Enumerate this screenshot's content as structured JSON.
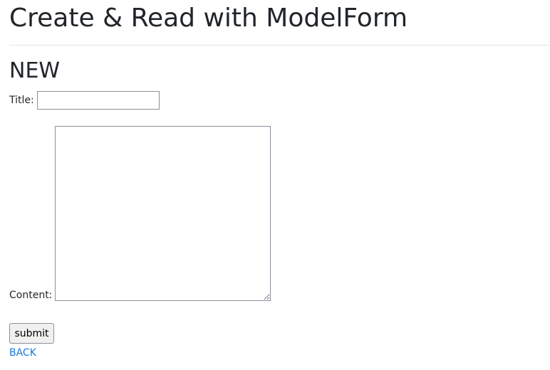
{
  "header": {
    "title": "Create & Read with ModelForm"
  },
  "section": {
    "title": "NEW"
  },
  "form": {
    "title_label": "Title:",
    "title_value": "",
    "content_label": "Content:",
    "content_value": "",
    "submit_label": "submit"
  },
  "nav": {
    "back_label": "BACK"
  },
  "colors": {
    "text": "#212529",
    "link": "#1a7ad9",
    "divider": "#e4e6e8",
    "input_border": "#8f8f9d",
    "button_bg": "#f0f0f0"
  }
}
